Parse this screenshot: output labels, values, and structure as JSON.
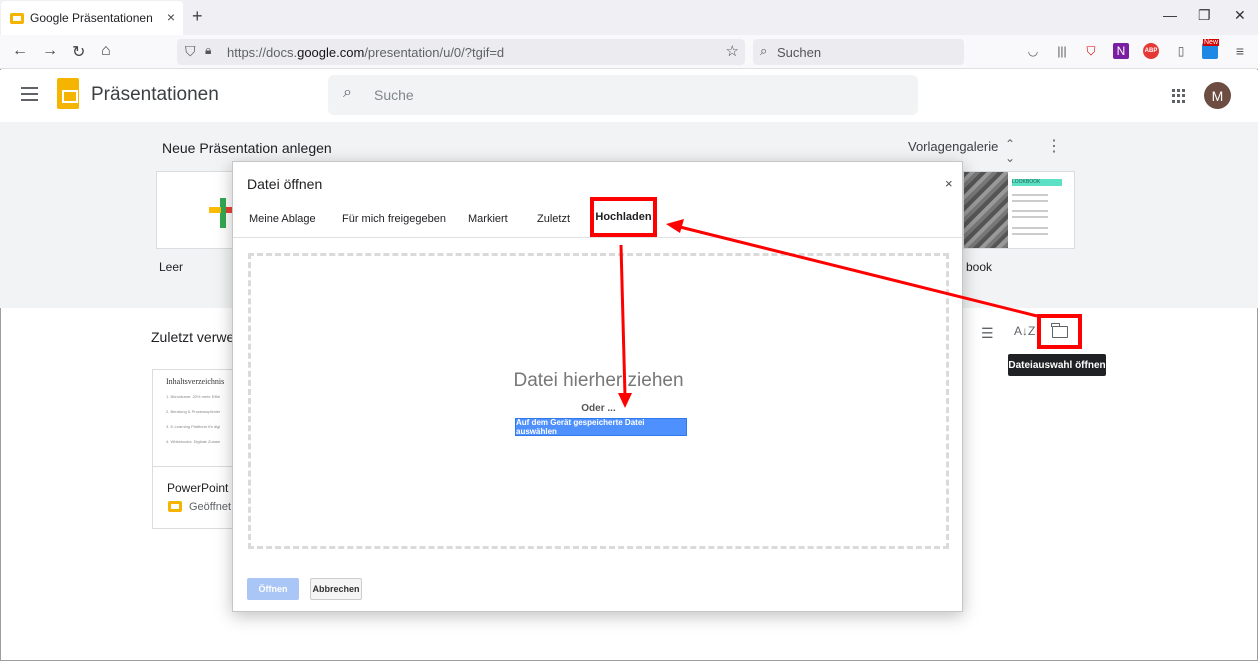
{
  "browser": {
    "tab_title": "Google Präsentationen",
    "tab_close": "×",
    "new_tab": "+",
    "url_prefix": "https://docs.",
    "url_host": "google.com",
    "url_path": "/presentation/u/0/?tgif=d",
    "search_placeholder": "Suchen",
    "ext_badge": "New"
  },
  "app": {
    "title": "Präsentationen",
    "search_placeholder": "Suche",
    "avatar_letter": "M"
  },
  "templates": {
    "section_title": "Neue Präsentation anlegen",
    "gallery_label": "Vorlagengalerie",
    "blank_label": "Leer",
    "lookbook_label": "book",
    "lookbook_head": "LOOKBOOK"
  },
  "recent": {
    "section_title": "Zuletzt verwe",
    "doc_heading": "Inhaltsverzeichnis",
    "doc_lines": [
      "1. Büroräume: 20% mehr Effizi",
      "2. Beratung & Prozessoptimiere",
      "3. E-Learning Plattform für digit",
      "4. Whitebooks: Digitale Zusamm"
    ],
    "doc_name": "PowerPoint",
    "doc_opened": "Geöffnet",
    "tooltip": "Dateiauswahl öffnen"
  },
  "dialog": {
    "title": "Datei öffnen",
    "close": "×",
    "tabs": [
      "Meine Ablage",
      "Für mich freigegeben",
      "Markiert",
      "Zuletzt"
    ],
    "active_tab": "Hochladen",
    "drop_text": "Datei hierher ziehen",
    "or_text": "Oder ...",
    "pick_button": "Auf dem Gerät gespeicherte Datei auswählen",
    "open_button": "Öffnen",
    "cancel_button": "Abbrechen"
  },
  "colors": {
    "annotation": "#ff0000",
    "slides_yellow": "#f4b400",
    "button_blue": "#4d90fe"
  }
}
